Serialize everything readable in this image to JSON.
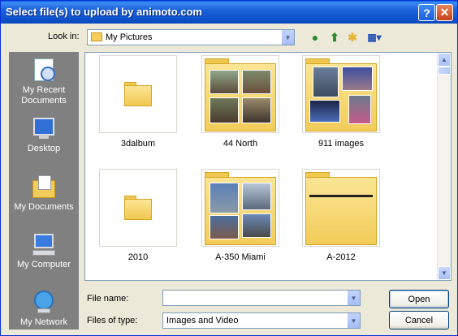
{
  "window": {
    "title": "Select file(s) to upload by animoto.com"
  },
  "toolbar": {
    "look_in_label": "Look in:",
    "look_in_value": "My Pictures",
    "back_icon": "back-icon",
    "up_icon": "up-folder-icon",
    "new_folder_icon": "new-folder-icon",
    "view_icon": "views-menu-icon"
  },
  "places": [
    {
      "label": "My Recent Documents",
      "icon": "recent-documents-icon"
    },
    {
      "label": "Desktop",
      "icon": "desktop-icon"
    },
    {
      "label": "My Documents",
      "icon": "my-documents-icon"
    },
    {
      "label": "My Computer",
      "icon": "my-computer-icon"
    },
    {
      "label": "My Network",
      "icon": "my-network-icon"
    }
  ],
  "files": [
    {
      "name": "3dalbum"
    },
    {
      "name": "44 North"
    },
    {
      "name": "911 images"
    },
    {
      "name": "2010"
    },
    {
      "name": "A-350 Miami"
    },
    {
      "name": "A-2012"
    }
  ],
  "form": {
    "file_name_label": "File name:",
    "file_name_value": "",
    "files_of_type_label": "Files of type:",
    "files_of_type_value": "Images and Video"
  },
  "buttons": {
    "open": "Open",
    "cancel": "Cancel"
  },
  "colors": {
    "titlebar": "#0a5fd8",
    "places_bar": "#808080",
    "folder": "#f2cc59"
  }
}
